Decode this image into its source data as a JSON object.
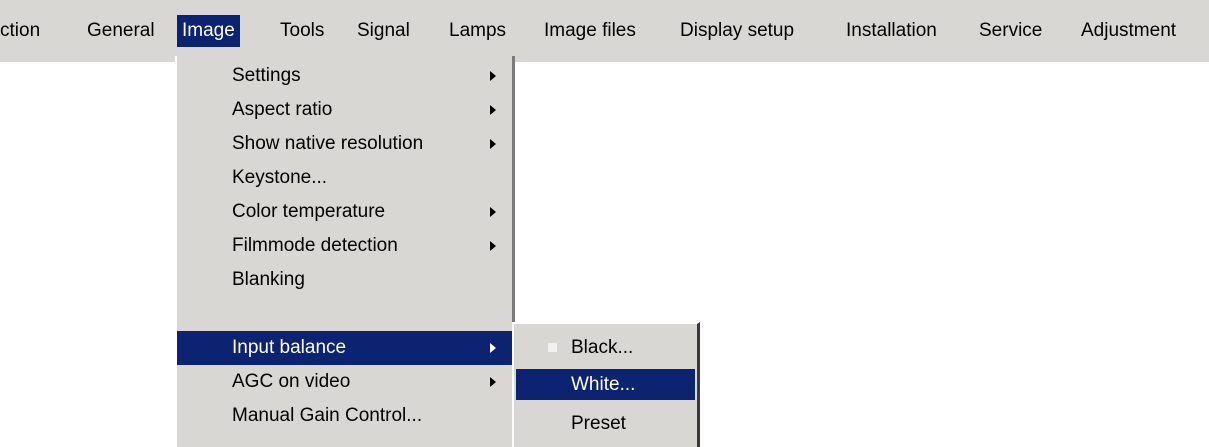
{
  "menubar": {
    "items": [
      {
        "label": "ction"
      },
      {
        "label": "General"
      },
      {
        "label": "Image",
        "selected": true
      },
      {
        "label": "Tools"
      },
      {
        "label": "Signal"
      },
      {
        "label": "Lamps"
      },
      {
        "label": "Image files"
      },
      {
        "label": "Display setup"
      },
      {
        "label": "Installation"
      },
      {
        "label": "Service"
      },
      {
        "label": "Adjustment"
      }
    ]
  },
  "image_menu": {
    "items": [
      {
        "label": "Settings",
        "has_submenu": true
      },
      {
        "label": "Aspect ratio",
        "has_submenu": true
      },
      {
        "label": "Show native resolution",
        "has_submenu": true
      },
      {
        "label": "Keystone...",
        "has_submenu": false
      },
      {
        "label": "Color temperature",
        "has_submenu": true
      },
      {
        "label": "Filmmode detection",
        "has_submenu": true
      },
      {
        "label": "Blanking",
        "has_submenu": false
      },
      {
        "label": "Input balance",
        "has_submenu": true,
        "highlighted": true
      },
      {
        "label": "AGC on video",
        "has_submenu": true
      },
      {
        "label": "Manual Gain Control...",
        "has_submenu": false
      }
    ]
  },
  "input_balance_submenu": {
    "items": [
      {
        "label": "Black...",
        "bullet": true
      },
      {
        "label": "White...",
        "highlighted": true
      },
      {
        "label": "Preset"
      }
    ]
  },
  "colors": {
    "menu_background": "#d9d7d3",
    "highlight": "#0b2370",
    "highlight_text": "#ffffff"
  }
}
